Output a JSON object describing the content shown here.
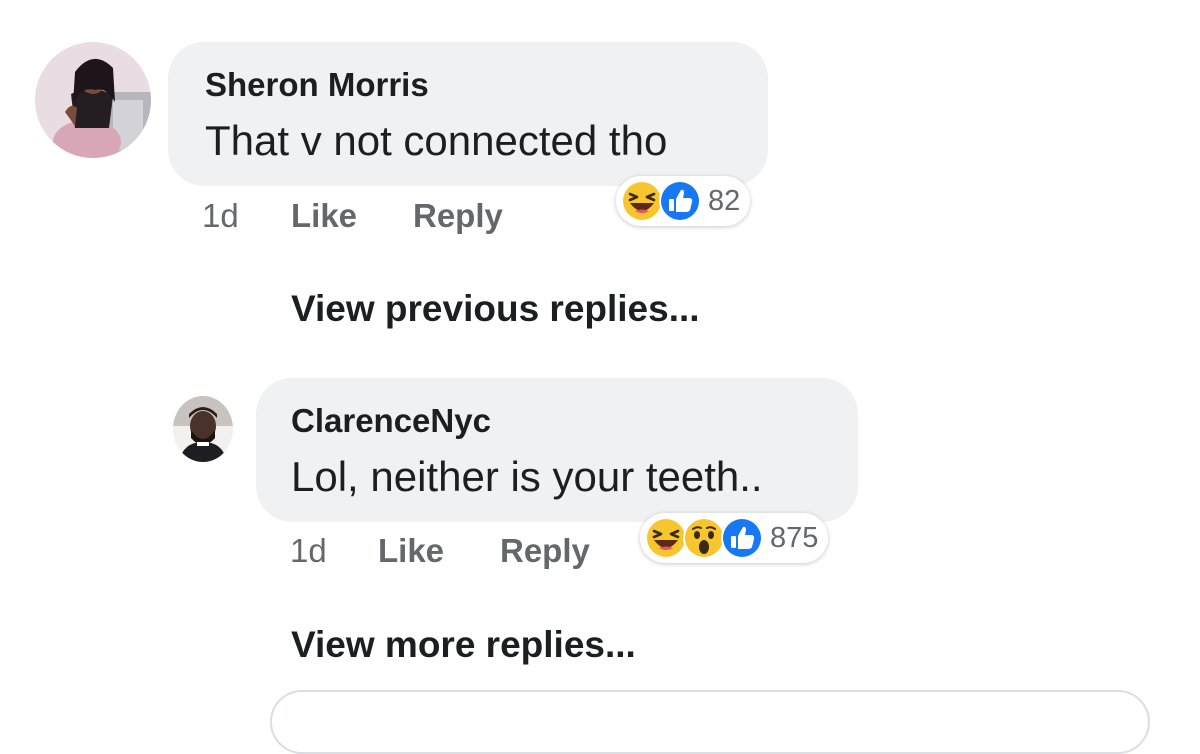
{
  "comments": [
    {
      "author": "Sheron Morris",
      "text": "That v not connected tho",
      "time": "1d",
      "like_label": "Like",
      "reply_label": "Reply",
      "reactions": {
        "icons": [
          "haha-icon",
          "like-icon"
        ],
        "count": "82"
      }
    }
  ],
  "view_previous_label": "View previous replies...",
  "replies": [
    {
      "author": "ClarenceNyc",
      "text": "Lol, neither is your teeth..",
      "time": "1d",
      "like_label": "Like",
      "reply_label": "Reply",
      "reactions": {
        "icons": [
          "haha-icon",
          "wow-icon",
          "like-icon"
        ],
        "count": "875"
      }
    }
  ],
  "view_more_label": "View more replies...",
  "colors": {
    "bubble": "#f0f1f3",
    "like_blue": "#1877f2",
    "emoji_yellow": "#f7c52e",
    "meta_gray": "#65676b"
  }
}
